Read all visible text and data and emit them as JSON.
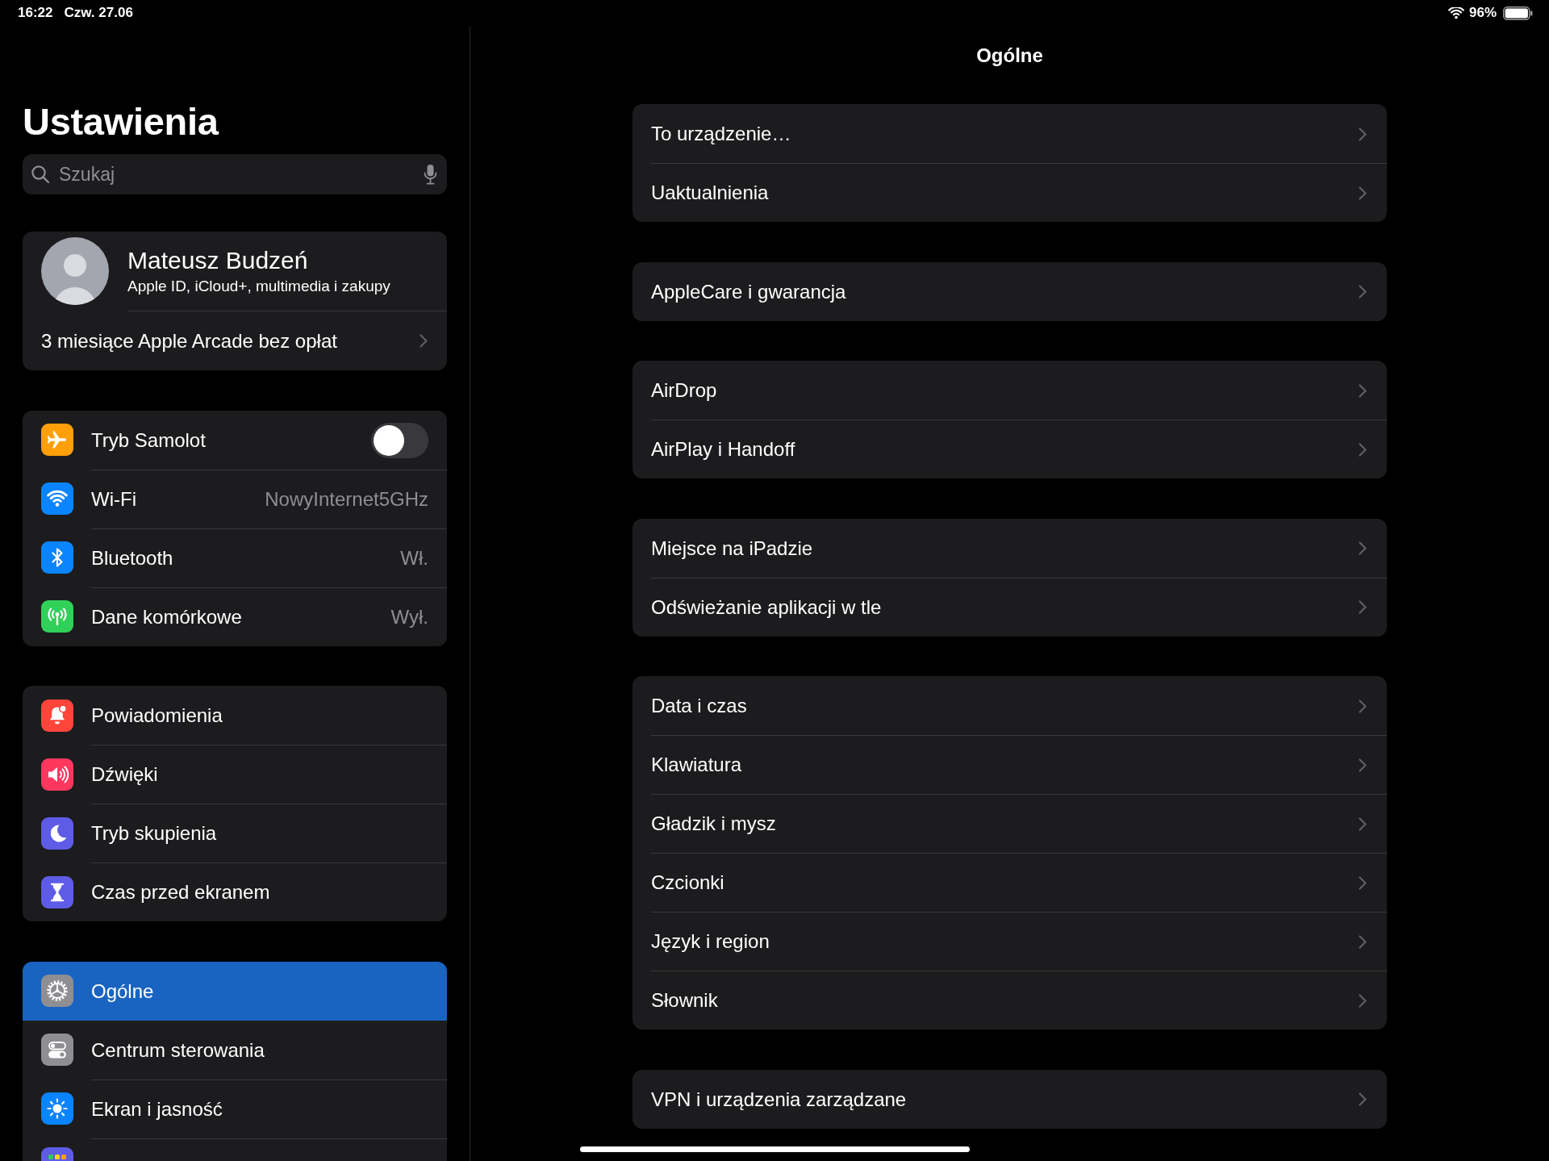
{
  "status_bar": {
    "time": "16:22",
    "date": "Czw. 27.06",
    "battery": "96%"
  },
  "sidebar": {
    "title": "Ustawienia",
    "search": {
      "placeholder": "Szukaj"
    },
    "account": {
      "name": "Mateusz Budzeń",
      "subtitle": "Apple ID, iCloud+, multimedia i zakupy",
      "offer": "3 miesiące Apple Arcade bez opłat"
    },
    "groups": [
      {
        "items": [
          {
            "label": "Tryb Samolot",
            "kind": "toggle",
            "on": false,
            "selected": false,
            "color": "#ff9f0a"
          },
          {
            "label": "Wi-Fi",
            "kind": "value",
            "value": "NowyInternet5GHz",
            "selected": false,
            "color": "#0a84ff"
          },
          {
            "label": "Bluetooth",
            "kind": "value",
            "value": "Wł.",
            "selected": false,
            "color": "#0a84ff"
          },
          {
            "label": "Dane komórkowe",
            "kind": "value",
            "value": "Wył.",
            "selected": false,
            "color": "#30d158"
          }
        ]
      },
      {
        "items": [
          {
            "label": "Powiadomienia",
            "kind": "link",
            "selected": false,
            "color": "#ff453a"
          },
          {
            "label": "Dźwięki",
            "kind": "link",
            "selected": false,
            "color": "#ff375f"
          },
          {
            "label": "Tryb skupienia",
            "kind": "link",
            "selected": false,
            "color": "#5e5ce6"
          },
          {
            "label": "Czas przed ekranem",
            "kind": "link",
            "selected": false,
            "color": "#5e5ce6"
          }
        ]
      },
      {
        "items": [
          {
            "label": "Ogólne",
            "kind": "link",
            "selected": true,
            "color": "#8e8e93"
          },
          {
            "label": "Centrum sterowania",
            "kind": "link",
            "selected": false,
            "color": "#8e8e93"
          },
          {
            "label": "Ekran i jasność",
            "kind": "link",
            "selected": false,
            "color": "#0a84ff"
          },
          {
            "kind": "link",
            "selected": false,
            "color": "#5e5ce6"
          }
        ]
      }
    ]
  },
  "detail": {
    "title": "Ogólne",
    "groups": [
      {
        "items": [
          {
            "label": "To urządzenie…"
          },
          {
            "label": "Uaktualnienia"
          }
        ]
      },
      {
        "items": [
          {
            "label": "AppleCare i gwarancja"
          }
        ]
      },
      {
        "items": [
          {
            "label": "AirDrop"
          },
          {
            "label": "AirPlay i Handoff"
          }
        ]
      },
      {
        "items": [
          {
            "label": "Miejsce na iPadzie"
          },
          {
            "label": "Odświeżanie aplikacji w tle"
          }
        ]
      },
      {
        "items": [
          {
            "label": "Data i czas"
          },
          {
            "label": "Klawiatura"
          },
          {
            "label": "Gładzik i mysz"
          },
          {
            "label": "Czcionki"
          },
          {
            "label": "Język i region"
          },
          {
            "label": "Słownik"
          }
        ]
      },
      {
        "items": [
          {
            "label": "VPN i urządzenia zarządzane"
          }
        ]
      }
    ]
  }
}
